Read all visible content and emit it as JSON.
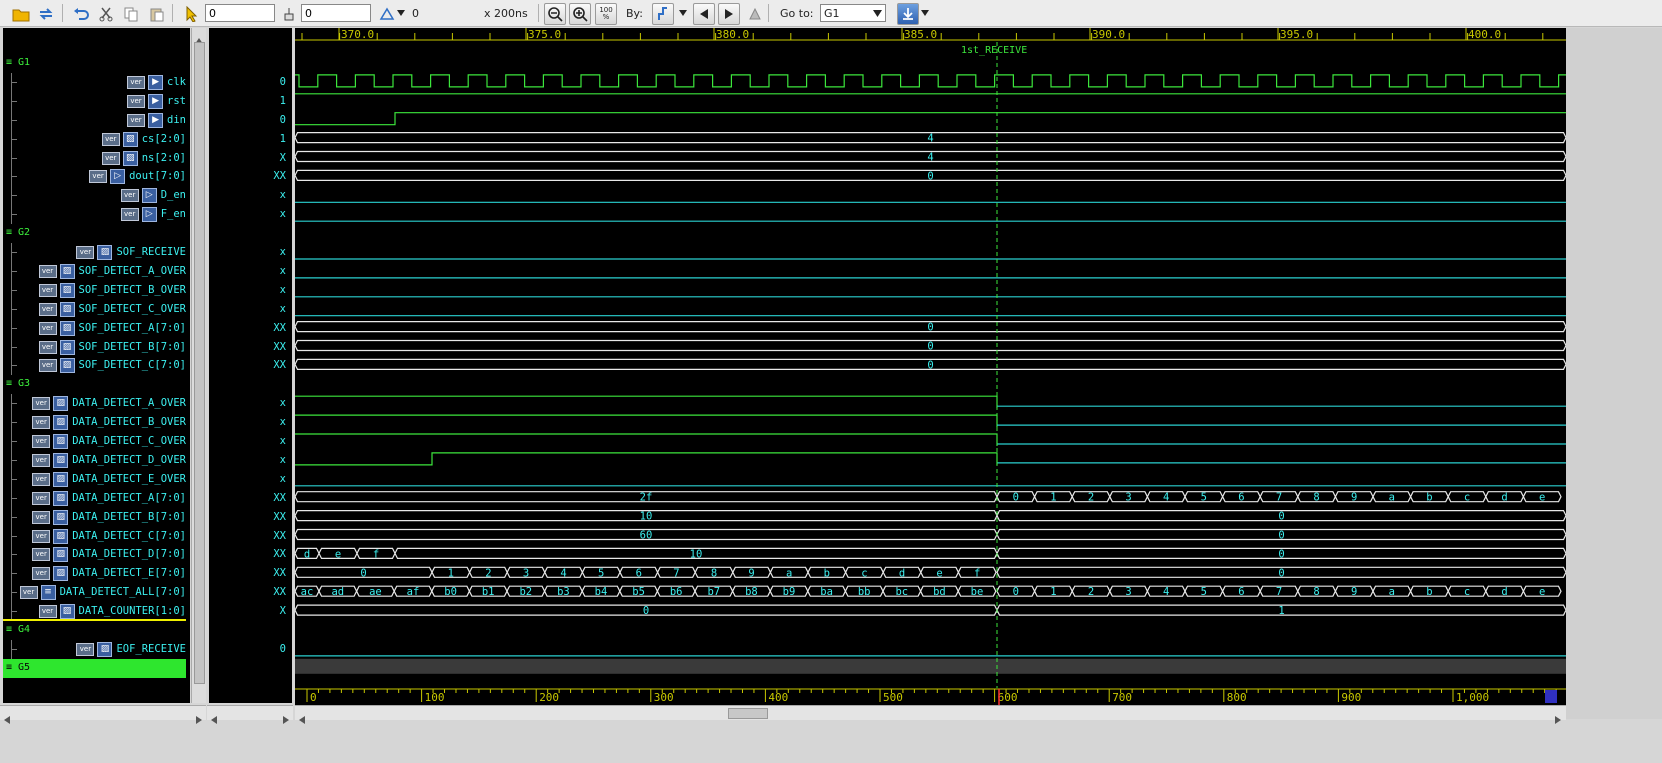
{
  "toolbar": {
    "time_value": "0",
    "cursor_value": "0",
    "step_value": "0",
    "scale_label": "x 200ns",
    "zoom_full_label": "100\n%",
    "by_label": "By:",
    "goto_label": "Go to:",
    "goto_selected": "G1"
  },
  "timeline": {
    "top_ticks": [
      "370.0",
      "375.0",
      "380.0",
      "385.0",
      "390.0",
      "395.0",
      "400.0"
    ],
    "marker_label": "1st_RECEIVE",
    "bottom_ticks": [
      "0",
      "100",
      "200",
      "300",
      "400",
      "500",
      "600",
      "700",
      "800",
      "900",
      "1,000"
    ]
  },
  "colors": {
    "wave_green": "#3ce63c",
    "wave_cyan": "#2ad0d0",
    "bus_line": "#e8e8e8",
    "bus_text": "#3cf0f0",
    "group_green": "#3cf23c",
    "marker_green": "#3ce63c",
    "selection_yellow": "#f0f000"
  },
  "groups": [
    {
      "name": "G1",
      "signals": [
        {
          "name": "clk",
          "icon": "input-port-icon",
          "value": "0"
        },
        {
          "name": "rst",
          "icon": "input-port-icon",
          "value": "1"
        },
        {
          "name": "din",
          "icon": "input-port-icon",
          "value": "0"
        },
        {
          "name": "cs[2:0]",
          "icon": "register-icon",
          "value": "1"
        },
        {
          "name": "ns[2:0]",
          "icon": "register-icon",
          "value": "X"
        },
        {
          "name": "dout[7:0]",
          "icon": "output-port-icon",
          "value": "XX"
        },
        {
          "name": "D_en",
          "icon": "output-port-icon",
          "value": "x"
        },
        {
          "name": "F_en",
          "icon": "output-port-icon",
          "value": "x"
        }
      ]
    },
    {
      "name": "G2",
      "signals": [
        {
          "name": "SOF_RECEIVE",
          "icon": "register-icon",
          "value": "x"
        },
        {
          "name": "SOF_DETECT_A_OVER",
          "icon": "register-icon",
          "value": "x"
        },
        {
          "name": "SOF_DETECT_B_OVER",
          "icon": "register-icon",
          "value": "x"
        },
        {
          "name": "SOF_DETECT_C_OVER",
          "icon": "register-icon",
          "value": "x"
        },
        {
          "name": "SOF_DETECT_A[7:0]",
          "icon": "register-icon",
          "value": "XX"
        },
        {
          "name": "SOF_DETECT_B[7:0]",
          "icon": "register-icon",
          "value": "XX"
        },
        {
          "name": "SOF_DETECT_C[7:0]",
          "icon": "register-icon",
          "value": "XX"
        }
      ]
    },
    {
      "name": "G3",
      "signals": [
        {
          "name": "DATA_DETECT_A_OVER",
          "icon": "register-icon",
          "value": "x"
        },
        {
          "name": "DATA_DETECT_B_OVER",
          "icon": "register-icon",
          "value": "x"
        },
        {
          "name": "DATA_DETECT_C_OVER",
          "icon": "register-icon",
          "value": "x"
        },
        {
          "name": "DATA_DETECT_D_OVER",
          "icon": "register-icon",
          "value": "x"
        },
        {
          "name": "DATA_DETECT_E_OVER",
          "icon": "register-icon",
          "value": "x"
        },
        {
          "name": "DATA_DETECT_A[7:0]",
          "icon": "register-icon",
          "value": "XX"
        },
        {
          "name": "DATA_DETECT_B[7:0]",
          "icon": "register-icon",
          "value": "XX"
        },
        {
          "name": "DATA_DETECT_C[7:0]",
          "icon": "register-icon",
          "value": "XX"
        },
        {
          "name": "DATA_DETECT_D[7:0]",
          "icon": "register-icon",
          "value": "XX"
        },
        {
          "name": "DATA_DETECT_E[7:0]",
          "icon": "register-icon",
          "value": "XX"
        },
        {
          "name": "DATA_DETECT_ALL[7:0]",
          "icon": "wire-icon",
          "value": "XX"
        },
        {
          "name": "DATA_COUNTER[1:0]",
          "icon": "register-icon",
          "value": "X"
        }
      ]
    },
    {
      "name": "G4",
      "signals": [
        {
          "name": "EOF_RECEIVE",
          "icon": "register-icon",
          "value": "0"
        }
      ]
    },
    {
      "name": "G5",
      "signals": []
    }
  ],
  "waves": {
    "cs": {
      "label": "4"
    },
    "ns": {
      "label": "4"
    },
    "dout": {
      "label": "0"
    },
    "sof_a": {
      "label": "0"
    },
    "sof_b": {
      "label": "0"
    },
    "sof_c": {
      "label": "0"
    },
    "dda_before": "2f",
    "dda_after": [
      "0",
      "1",
      "2",
      "3",
      "4",
      "5",
      "6",
      "7",
      "8",
      "9",
      "a",
      "b",
      "c",
      "d",
      "e"
    ],
    "ddb_before": "10",
    "ddb_after": "0",
    "ddc_before": "60",
    "ddc_after": "0",
    "ddd_before": [
      "d",
      "e",
      "f",
      "10"
    ],
    "ddd_after": "0",
    "dde_before": [
      "0",
      "1",
      "2",
      "3",
      "4",
      "5",
      "6",
      "7",
      "8",
      "9",
      "a",
      "b",
      "c",
      "d",
      "e",
      "f"
    ],
    "dde_after": "0",
    "all_before": [
      "ac",
      "ad",
      "ae",
      "af",
      "b0",
      "b1",
      "b2",
      "b3",
      "b4",
      "b5",
      "b6",
      "b7",
      "b8",
      "b9",
      "ba",
      "bb",
      "bc",
      "bd",
      "be"
    ],
    "all_after": [
      "0",
      "1",
      "2",
      "3",
      "4",
      "5",
      "6",
      "7",
      "8",
      "9",
      "a",
      "b",
      "c",
      "d",
      "e"
    ],
    "counter_before": "0",
    "counter_after": "1"
  }
}
